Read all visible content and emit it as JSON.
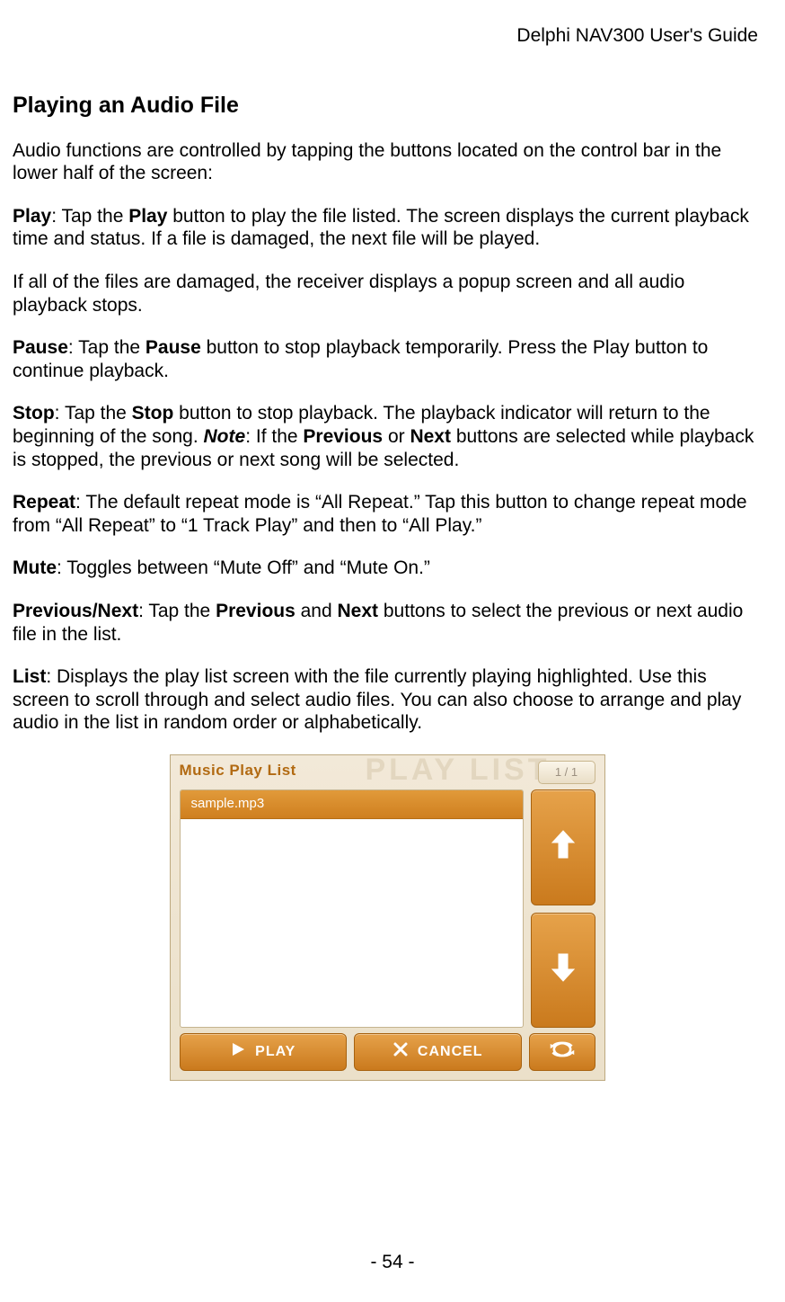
{
  "header": {
    "doc_title": "Delphi NAV300 User's Guide"
  },
  "footer": {
    "page_number": "- 54 -"
  },
  "section": {
    "heading": "Playing an Audio File",
    "intro": "Audio functions are controlled by tapping the buttons located on the control bar in the lower half of the screen:",
    "play": {
      "label": "Play",
      "bold_word": "Play",
      "before": ":  Tap the ",
      "after": " button to play the file listed.  The screen displays the current playback time and status.  If a file is damaged, the next file will be played."
    },
    "play_note": "If all of the files are damaged, the receiver displays a popup screen and all audio playback stops.",
    "pause": {
      "label": "Pause",
      "before": ": Tap the ",
      "bold_word": "Pause",
      "after": " button to stop playback temporarily.  Press the Play button to continue playback."
    },
    "stop": {
      "label": "Stop",
      "t1": ": Tap the ",
      "b1": "Stop",
      "t2": " button to stop playback.  The playback indicator will return to the beginning of the song.  ",
      "note_label": "Note",
      "t3": ": If the ",
      "b2": "Previous",
      "t4": " or ",
      "b3": "Next",
      "t5": " buttons are selected while playback is stopped, the previous or next song will be selected."
    },
    "repeat": {
      "label": "Repeat",
      "text": ": The default repeat mode is “All Repeat.” Tap this button to change repeat mode from “All Repeat” to “1 Track Play” and then to “All Play.”"
    },
    "mute": {
      "label": "Mute",
      "text": ": Toggles between “Mute Off” and “Mute On.”"
    },
    "prevnext": {
      "label": "Previous/Next",
      "t1": ": Tap the ",
      "b1": "Previous",
      "t2": " and ",
      "b2": "Next",
      "t3": " buttons to select the previous or next audio file in the list."
    },
    "list": {
      "label": "List",
      "text": ": Displays the play list screen with the file currently playing highlighted.  Use this screen to scroll through and select audio files.  You can also choose to arrange and play audio in the list in random order or alphabetically."
    }
  },
  "device": {
    "title": "Music Play List",
    "ghost": "PLAY LIST",
    "page_indicator": "1 / 1",
    "current_file": "sample.mp3",
    "buttons": {
      "play": "PLAY",
      "cancel": "CANCEL"
    }
  }
}
